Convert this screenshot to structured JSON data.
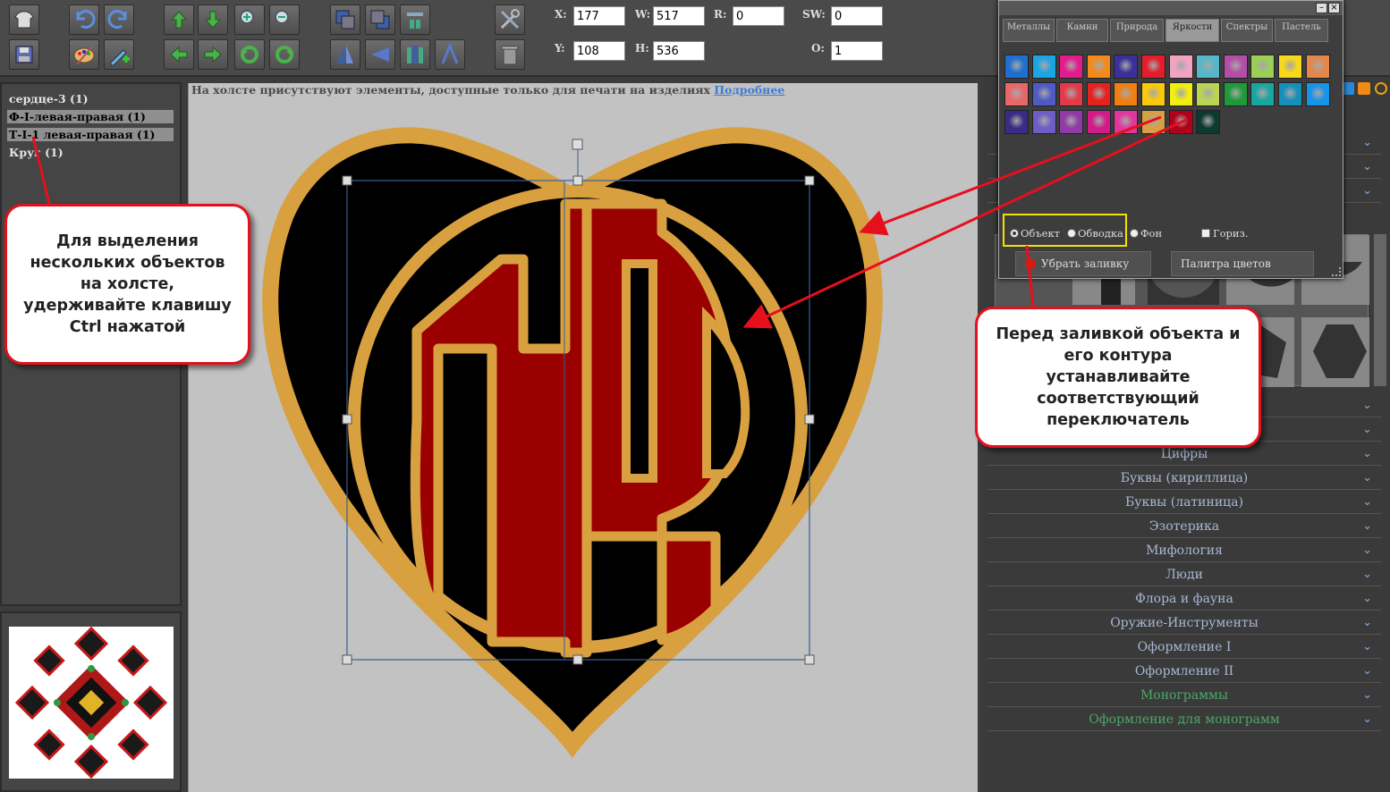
{
  "toolbar": {
    "fields": {
      "x": {
        "label": "X:",
        "value": "177"
      },
      "w": {
        "label": "W:",
        "value": "517"
      },
      "r": {
        "label": "R:",
        "value": "0"
      },
      "sw": {
        "label": "SW:",
        "value": "0"
      },
      "y": {
        "label": "Y:",
        "value": "108"
      },
      "h": {
        "label": "H:",
        "value": "536"
      },
      "o": {
        "label": "O:",
        "value": "1"
      }
    },
    "icons": [
      "shirt-icon",
      "undo-icon",
      "redo-icon",
      "move-up-icon",
      "move-down-icon",
      "zoom-in-icon",
      "zoom-out-icon",
      "bring-front-icon",
      "send-back-icon",
      "align-icon",
      "tools-icon",
      "save-icon",
      "palette-icon",
      "add-text-icon",
      "move-left-icon",
      "move-right-icon",
      "rotate-left-icon",
      "rotate-right-icon",
      "flip-horizontal-icon",
      "mirror-icon",
      "align-center-icon",
      "font-icon",
      "trash-icon"
    ]
  },
  "layers": {
    "items": [
      {
        "label": "сердце-3 (1)",
        "selected": false
      },
      {
        "label": "Ф-I-левая-правая (1)",
        "selected": true
      },
      {
        "label": "Т-I-1 левая-правая (1)",
        "selected": true
      },
      {
        "label": "Круг (1)",
        "selected": false
      }
    ]
  },
  "canvas": {
    "notice": "На холсте присутствуют элементы, доступные только для печати на изделиях",
    "notice_link": "Подробнее",
    "colors": {
      "outline": "#d9a040",
      "heart": "#000000",
      "letters": "#9b0000"
    }
  },
  "palette": {
    "tabs": [
      "Металлы",
      "Камни",
      "Природа",
      "Яркости",
      "Спектры",
      "Пастель"
    ],
    "active_tab": "Яркости",
    "swatches": [
      "#1f6fd1",
      "#19a6e3",
      "#e31b8d",
      "#f28a1e",
      "#3b2f9a",
      "#e51c2c",
      "#f2a3c2",
      "#55b7c9",
      "#b24ea6",
      "#9bcf56",
      "#f7d81a",
      "#e3874b",
      "#e8686a",
      "#4f5bc4",
      "#e33a4a",
      "#e52220",
      "#f07f12",
      "#f9c90b",
      "#f2ee11",
      "#bcd453",
      "#1f9a3a",
      "#1aa6a0",
      "#1590b9",
      "#1794e8",
      "#3b2b85",
      "#6f5cc4",
      "#8f3aa6",
      "#d21b89",
      "#e2369f",
      "#d8a045",
      "#b0001a",
      "#0c3a2f"
    ],
    "radio": {
      "object": "Объект",
      "outline": "Обводка",
      "background": "Фон",
      "horizontal": "Гориз."
    },
    "buttons": {
      "remove_fill": "Убрать заливку",
      "color_palette": "Палитра цветов"
    }
  },
  "categories": [
    "Цифры",
    "Буквы (кириллица)",
    "Буквы (латиница)",
    "Эзотерика",
    "Мифология",
    "Люди",
    "Флора и фауна",
    "Оружие-Инструменты",
    "Оформление I",
    "Оформление II",
    "Монограммы",
    "Оформление для монограмм"
  ],
  "callouts": {
    "left": "Для выделения нескольких объектов на холсте, удерживайте клавишу Ctrl нажатой",
    "right": "Перед заливкой объекта и его контура устанавливайте соответствующий переключатель"
  }
}
